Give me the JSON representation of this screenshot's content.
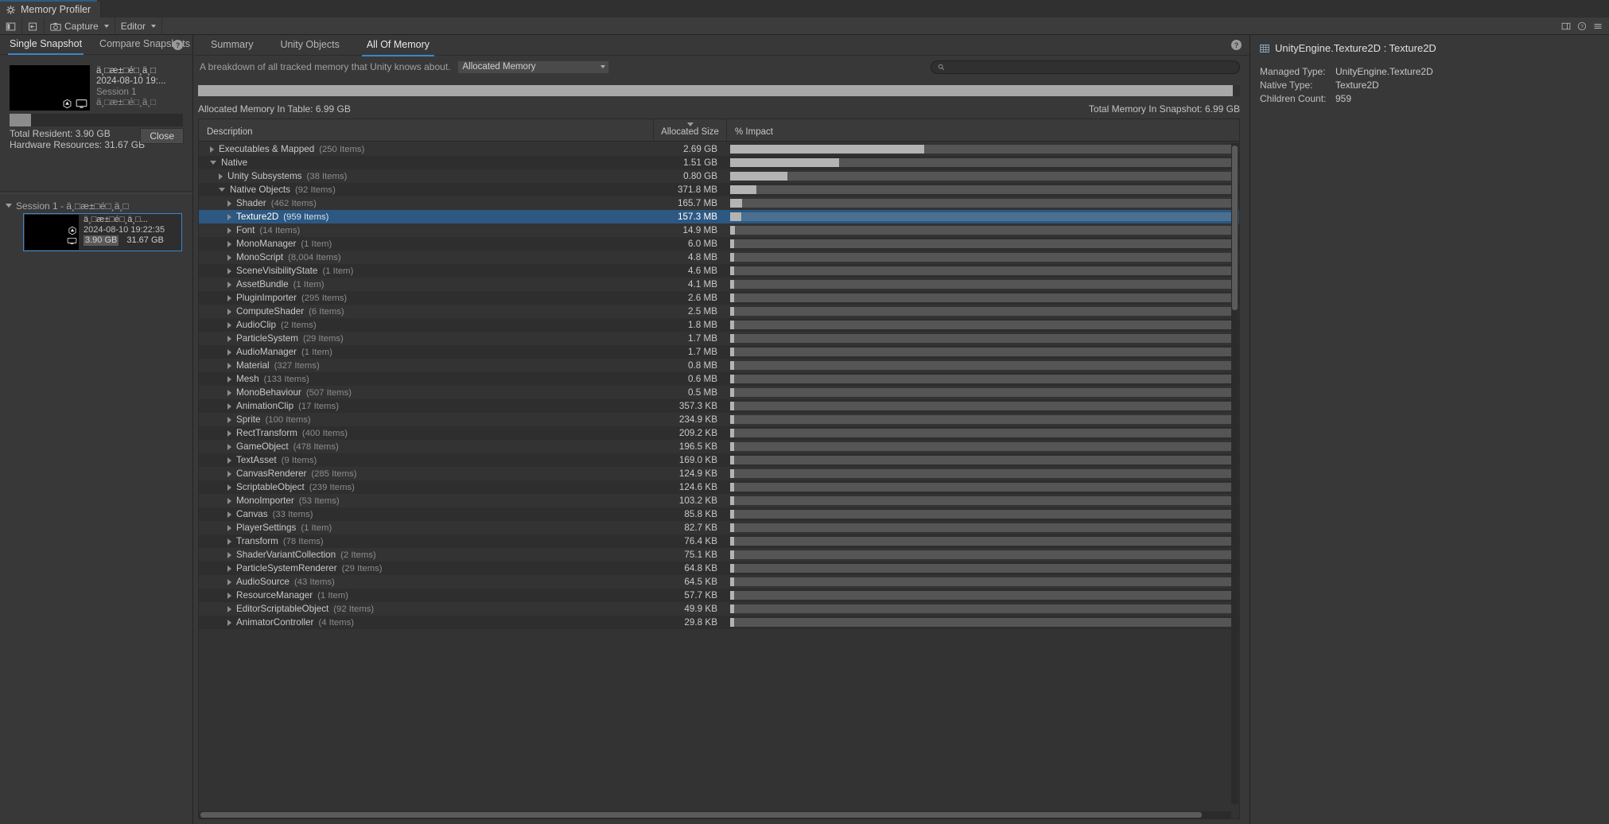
{
  "window": {
    "title": "Memory Profiler",
    "icon": "profiler-icon"
  },
  "toolbar": {
    "layout_icon": "panel-layout-icon",
    "import_icon": "import-snapshot-icon",
    "capture_label": "Capture",
    "capture_icon": "camera-icon",
    "target_label": "Editor",
    "right_icons": [
      "panel-toggle-icon",
      "help-icon",
      "menu-icon"
    ]
  },
  "left_panel": {
    "tabs": [
      {
        "label": "Single Snapshot",
        "active": true
      },
      {
        "label": "Compare Snapshots",
        "active": false
      }
    ],
    "help_icon": "help-icon",
    "snapshot": {
      "name": "ä¸□æ±□é□¸ä¸□",
      "date": "2024-08-10 19:...",
      "session": "Session 1",
      "sub": "ä¸□æ±□é□¸ä¸□",
      "thumb_icons": [
        "unity-logo-icon",
        "display-icon"
      ]
    },
    "stats": {
      "total_resident": "Total Resident: 3.90 GB",
      "hardware_resources": "Hardware Resources: 31.67 GB"
    },
    "close_label": "Close",
    "session_header": "Session 1 - ä¸□æ±□é□¸ä¸□",
    "session_item": {
      "name": "ä¸□æ±□é□¸ä¸□...",
      "date": "2024-08-10 19:22:35",
      "size_a": "3.90 GB",
      "size_b": "31.67 GB",
      "icons": [
        "unity-logo-icon",
        "display-icon"
      ]
    }
  },
  "center_panel": {
    "tabs": [
      {
        "label": "Summary",
        "active": false
      },
      {
        "label": "Unity Objects",
        "active": false
      },
      {
        "label": "All Of Memory",
        "active": true
      }
    ],
    "help_icon": "help-icon",
    "breakdown_text": "A breakdown of all tracked memory that Unity knows about.",
    "breakdown_selected": "Allocated Memory",
    "search_placeholder": "",
    "search_value": "",
    "search_icon": "search-icon",
    "allocated_in_table": "Allocated Memory In Table: 6.99 GB",
    "total_in_snapshot": "Total Memory In Snapshot: 6.99 GB",
    "columns": {
      "description": "Description",
      "allocated_size": "Allocated Size",
      "impact": "% Impact"
    },
    "sort_column": "allocated_size",
    "rows": [
      {
        "label": "Executables & Mapped",
        "count": "(250 Items)",
        "size": "2.69 GB",
        "impact": 38.5,
        "indent": 0,
        "state": "collapsed",
        "selected": false
      },
      {
        "label": "Native",
        "count": "",
        "size": "1.51 GB",
        "impact": 21.6,
        "indent": 0,
        "state": "expanded",
        "selected": false
      },
      {
        "label": "Unity Subsystems",
        "count": "(38 Items)",
        "size": "0.80 GB",
        "impact": 11.4,
        "indent": 1,
        "state": "collapsed",
        "selected": false
      },
      {
        "label": "Native Objects",
        "count": "(92 Items)",
        "size": "371.8 MB",
        "impact": 5.2,
        "indent": 1,
        "state": "expanded",
        "selected": false
      },
      {
        "label": "Shader",
        "count": "(462 Items)",
        "size": "165.7 MB",
        "impact": 2.3,
        "indent": 2,
        "state": "collapsed",
        "selected": false
      },
      {
        "label": "Texture2D",
        "count": "(959 Items)",
        "size": "157.3 MB",
        "impact": 2.2,
        "indent": 2,
        "state": "collapsed",
        "selected": true
      },
      {
        "label": "Font",
        "count": "(14 Items)",
        "size": "14.9 MB",
        "impact": 0.9,
        "indent": 2,
        "state": "collapsed",
        "selected": false
      },
      {
        "label": "MonoManager",
        "count": "(1 Item)",
        "size": "6.0 MB",
        "impact": 0.8,
        "indent": 2,
        "state": "collapsed",
        "selected": false
      },
      {
        "label": "MonoScript",
        "count": "(8,004 Items)",
        "size": "4.8 MB",
        "impact": 0.8,
        "indent": 2,
        "state": "collapsed",
        "selected": false
      },
      {
        "label": "SceneVisibilityState",
        "count": "(1 Item)",
        "size": "4.6 MB",
        "impact": 0.8,
        "indent": 2,
        "state": "collapsed",
        "selected": false
      },
      {
        "label": "AssetBundle",
        "count": "(1 Item)",
        "size": "4.1 MB",
        "impact": 0.8,
        "indent": 2,
        "state": "collapsed",
        "selected": false
      },
      {
        "label": "PluginImporter",
        "count": "(295 Items)",
        "size": "2.6 MB",
        "impact": 0.8,
        "indent": 2,
        "state": "collapsed",
        "selected": false
      },
      {
        "label": "ComputeShader",
        "count": "(6 Items)",
        "size": "2.5 MB",
        "impact": 0.8,
        "indent": 2,
        "state": "collapsed",
        "selected": false
      },
      {
        "label": "AudioClip",
        "count": "(2 Items)",
        "size": "1.8 MB",
        "impact": 0.8,
        "indent": 2,
        "state": "collapsed",
        "selected": false
      },
      {
        "label": "ParticleSystem",
        "count": "(29 Items)",
        "size": "1.7 MB",
        "impact": 0.8,
        "indent": 2,
        "state": "collapsed",
        "selected": false
      },
      {
        "label": "AudioManager",
        "count": "(1 Item)",
        "size": "1.7 MB",
        "impact": 0.8,
        "indent": 2,
        "state": "collapsed",
        "selected": false
      },
      {
        "label": "Material",
        "count": "(327 Items)",
        "size": "0.8 MB",
        "impact": 0.8,
        "indent": 2,
        "state": "collapsed",
        "selected": false
      },
      {
        "label": "Mesh",
        "count": "(133 Items)",
        "size": "0.6 MB",
        "impact": 0.8,
        "indent": 2,
        "state": "collapsed",
        "selected": false
      },
      {
        "label": "MonoBehaviour",
        "count": "(507 Items)",
        "size": "0.5 MB",
        "impact": 0.8,
        "indent": 2,
        "state": "collapsed",
        "selected": false
      },
      {
        "label": "AnimationClip",
        "count": "(17 Items)",
        "size": "357.3 KB",
        "impact": 0.8,
        "indent": 2,
        "state": "collapsed",
        "selected": false
      },
      {
        "label": "Sprite",
        "count": "(100 Items)",
        "size": "234.9 KB",
        "impact": 0.8,
        "indent": 2,
        "state": "collapsed",
        "selected": false
      },
      {
        "label": "RectTransform",
        "count": "(400 Items)",
        "size": "209.2 KB",
        "impact": 0.8,
        "indent": 2,
        "state": "collapsed",
        "selected": false
      },
      {
        "label": "GameObject",
        "count": "(478 Items)",
        "size": "196.5 KB",
        "impact": 0.8,
        "indent": 2,
        "state": "collapsed",
        "selected": false
      },
      {
        "label": "TextAsset",
        "count": "(9 Items)",
        "size": "169.0 KB",
        "impact": 0.8,
        "indent": 2,
        "state": "collapsed",
        "selected": false
      },
      {
        "label": "CanvasRenderer",
        "count": "(285 Items)",
        "size": "124.9 KB",
        "impact": 0.8,
        "indent": 2,
        "state": "collapsed",
        "selected": false
      },
      {
        "label": "ScriptableObject",
        "count": "(239 Items)",
        "size": "124.6 KB",
        "impact": 0.8,
        "indent": 2,
        "state": "collapsed",
        "selected": false
      },
      {
        "label": "MonoImporter",
        "count": "(53 Items)",
        "size": "103.2 KB",
        "impact": 0.8,
        "indent": 2,
        "state": "collapsed",
        "selected": false
      },
      {
        "label": "Canvas",
        "count": "(33 Items)",
        "size": "85.8 KB",
        "impact": 0.8,
        "indent": 2,
        "state": "collapsed",
        "selected": false
      },
      {
        "label": "PlayerSettings",
        "count": "(1 Item)",
        "size": "82.7 KB",
        "impact": 0.8,
        "indent": 2,
        "state": "collapsed",
        "selected": false
      },
      {
        "label": "Transform",
        "count": "(78 Items)",
        "size": "76.4 KB",
        "impact": 0.8,
        "indent": 2,
        "state": "collapsed",
        "selected": false
      },
      {
        "label": "ShaderVariantCollection",
        "count": "(2 Items)",
        "size": "75.1 KB",
        "impact": 0.8,
        "indent": 2,
        "state": "collapsed",
        "selected": false
      },
      {
        "label": "ParticleSystemRenderer",
        "count": "(29 Items)",
        "size": "64.8 KB",
        "impact": 0.8,
        "indent": 2,
        "state": "collapsed",
        "selected": false
      },
      {
        "label": "AudioSource",
        "count": "(43 Items)",
        "size": "64.5 KB",
        "impact": 0.8,
        "indent": 2,
        "state": "collapsed",
        "selected": false
      },
      {
        "label": "ResourceManager",
        "count": "(1 Item)",
        "size": "57.7 KB",
        "impact": 0.8,
        "indent": 2,
        "state": "collapsed",
        "selected": false
      },
      {
        "label": "EditorScriptableObject",
        "count": "(92 Items)",
        "size": "49.9 KB",
        "impact": 0.8,
        "indent": 2,
        "state": "collapsed",
        "selected": false
      },
      {
        "label": "AnimatorController",
        "count": "(4 Items)",
        "size": "29.8 KB",
        "impact": 0.8,
        "indent": 2,
        "state": "collapsed",
        "selected": false
      }
    ]
  },
  "right_panel": {
    "title": "UnityEngine.Texture2D : Texture2D",
    "title_icon": "texture-icon",
    "fields": [
      {
        "key": "Managed Type:",
        "value": "UnityEngine.Texture2D"
      },
      {
        "key": "Native Type:",
        "value": "Texture2D"
      },
      {
        "key": "Children Count:",
        "value": "959"
      }
    ]
  },
  "colors": {
    "accent": "#3e84cb",
    "selection": "#2c5882",
    "panel_bg": "#383838",
    "bar_fill": "#a8a8a8"
  }
}
